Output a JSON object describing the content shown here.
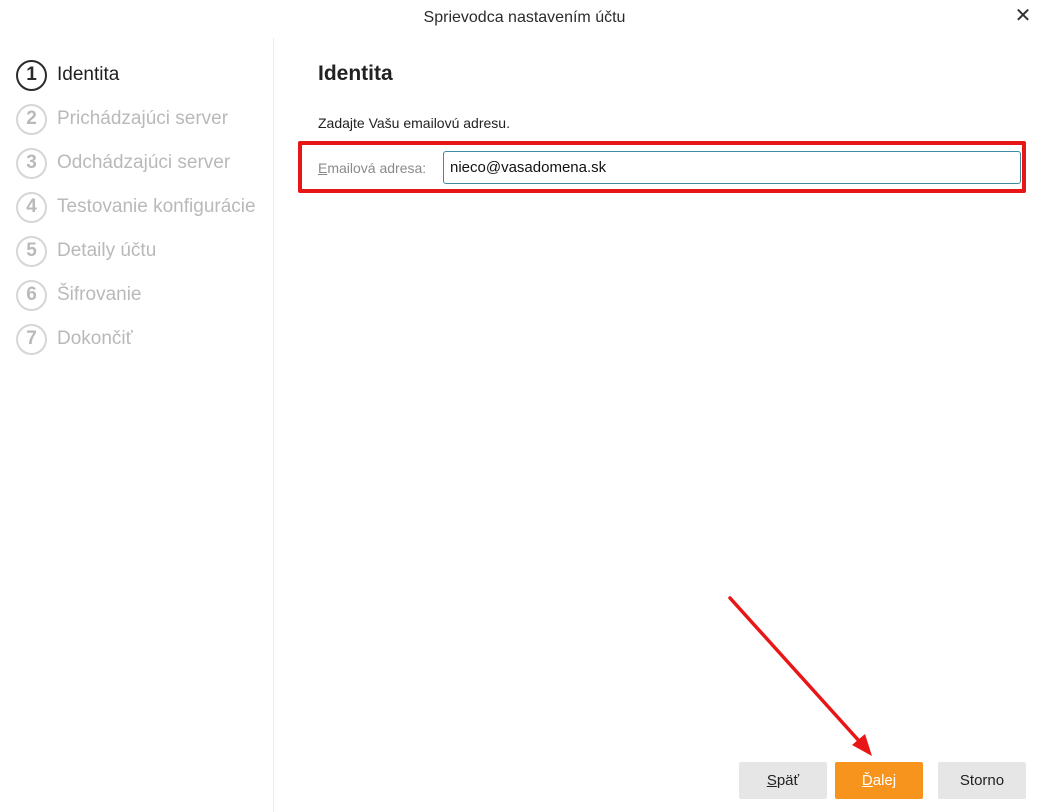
{
  "window": {
    "title": "Sprievodca nastavením účtu",
    "close_glyph": "✕"
  },
  "steps": [
    {
      "num": "1",
      "label": "Identita",
      "active": true
    },
    {
      "num": "2",
      "label": "Prichádzajúci server",
      "active": false
    },
    {
      "num": "3",
      "label": "Odchádzajúci server",
      "active": false
    },
    {
      "num": "4",
      "label": "Testovanie konfigurácie",
      "active": false
    },
    {
      "num": "5",
      "label": "Detaily účtu",
      "active": false
    },
    {
      "num": "6",
      "label": "Šifrovanie",
      "active": false
    },
    {
      "num": "7",
      "label": "Dokončiť",
      "active": false
    }
  ],
  "main": {
    "heading": "Identita",
    "instruction": "Zadajte Vašu emailovú adresu.",
    "email_label_access_key": "E",
    "email_label_rest": "mailová adresa:",
    "email_value": "nieco@vasadomena.sk"
  },
  "buttons": {
    "back_key": "S",
    "back_rest": "päť",
    "next_key": "Ď",
    "next_rest": "alej",
    "cancel": "Storno"
  },
  "colors": {
    "accent": "#f7941d",
    "highlight": "#e81616",
    "input_border": "#3c8ba0"
  }
}
